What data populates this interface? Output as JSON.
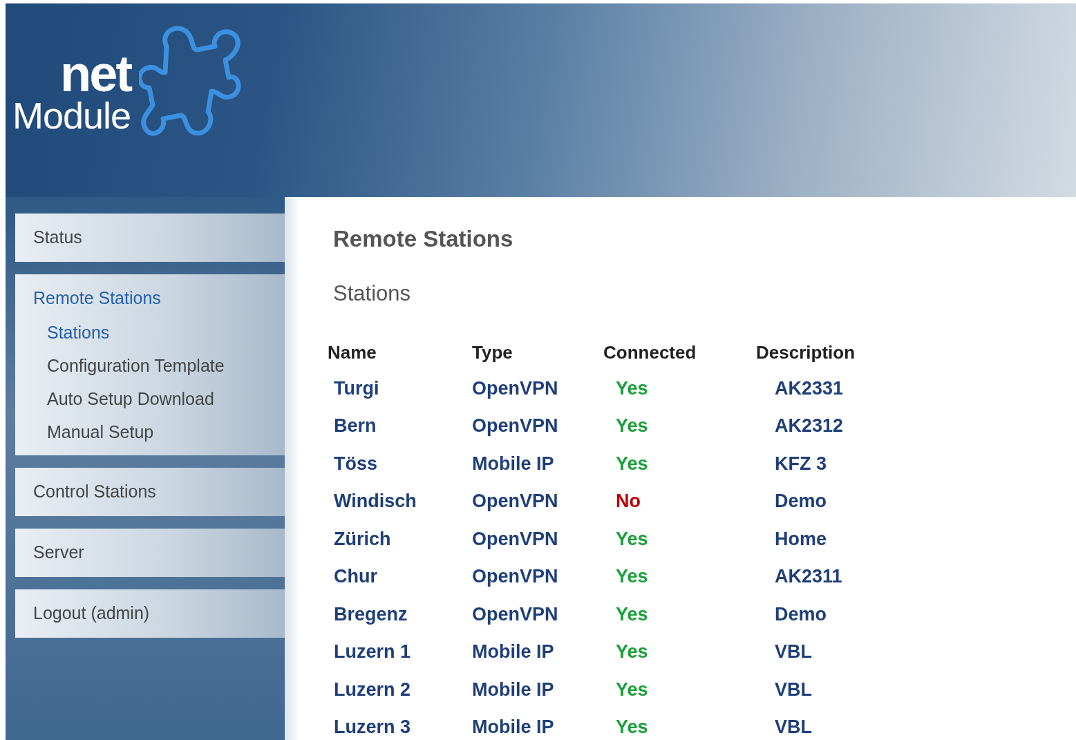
{
  "logo": {
    "word_1": "net",
    "word_2": "Module"
  },
  "nav": [
    {
      "label": "Status",
      "selected": false
    },
    {
      "label": "Remote Stations",
      "selected": true,
      "children": [
        {
          "label": "Stations",
          "selected": true
        },
        {
          "label": "Configuration Template",
          "selected": false
        },
        {
          "label": "Auto Setup Download",
          "selected": false
        },
        {
          "label": "Manual Setup",
          "selected": false
        }
      ]
    },
    {
      "label": "Control Stations",
      "selected": false
    },
    {
      "label": "Server",
      "selected": false
    },
    {
      "label": "Logout (admin)",
      "selected": false
    }
  ],
  "page_title": "Remote Stations",
  "section_title": "Stations",
  "table": {
    "columns": [
      "Name",
      "Type",
      "Connected",
      "Description"
    ],
    "rows": [
      {
        "name": "Turgi",
        "type": "OpenVPN",
        "connected": "Yes",
        "is_connected": true,
        "description": "AK2331"
      },
      {
        "name": "Bern",
        "type": "OpenVPN",
        "connected": "Yes",
        "is_connected": true,
        "description": "AK2312"
      },
      {
        "name": "Töss",
        "type": "Mobile IP",
        "connected": "Yes",
        "is_connected": true,
        "description": "KFZ 3"
      },
      {
        "name": "Windisch",
        "type": "OpenVPN",
        "connected": "No",
        "is_connected": false,
        "description": "Demo"
      },
      {
        "name": "Zürich",
        "type": "OpenVPN",
        "connected": "Yes",
        "is_connected": true,
        "description": "Home"
      },
      {
        "name": "Chur",
        "type": "OpenVPN",
        "connected": "Yes",
        "is_connected": true,
        "description": "AK2311"
      },
      {
        "name": "Bregenz",
        "type": "OpenVPN",
        "connected": "Yes",
        "is_connected": true,
        "description": "Demo"
      },
      {
        "name": "Luzern 1",
        "type": "Mobile IP",
        "connected": "Yes",
        "is_connected": true,
        "description": "VBL"
      },
      {
        "name": "Luzern 2",
        "type": "Mobile IP",
        "connected": "Yes",
        "is_connected": true,
        "description": "VBL"
      },
      {
        "name": "Luzern 3",
        "type": "Mobile IP",
        "connected": "Yes",
        "is_connected": true,
        "description": "VBL"
      }
    ]
  }
}
